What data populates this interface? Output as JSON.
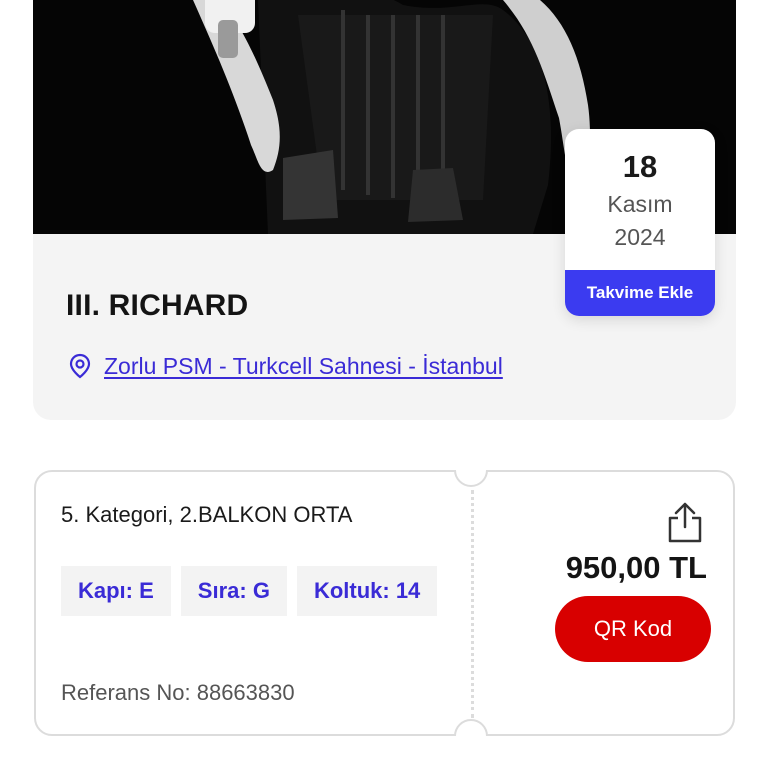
{
  "event": {
    "title": "III. RICHARD",
    "venue": "Zorlu PSM - Turkcell Sahnesi - İstanbul"
  },
  "date": {
    "day": "18",
    "month": "Kasım",
    "year": "2024",
    "calendar_button": "Takvime Ekle"
  },
  "ticket": {
    "category": "5. Kategori, 2.BALKON ORTA",
    "gate": "Kapı: E",
    "row": "Sıra: G",
    "seat": "Koltuk: 14",
    "reference": "Referans No: 88663830",
    "price": "950,00 TL",
    "qr_button": "QR Kod"
  },
  "icons": {
    "venue": "location-pin-icon",
    "share": "share-icon"
  },
  "colors": {
    "accent": "#3b3bf0",
    "link": "#3a2bd6",
    "qr_button": "#d80000"
  }
}
